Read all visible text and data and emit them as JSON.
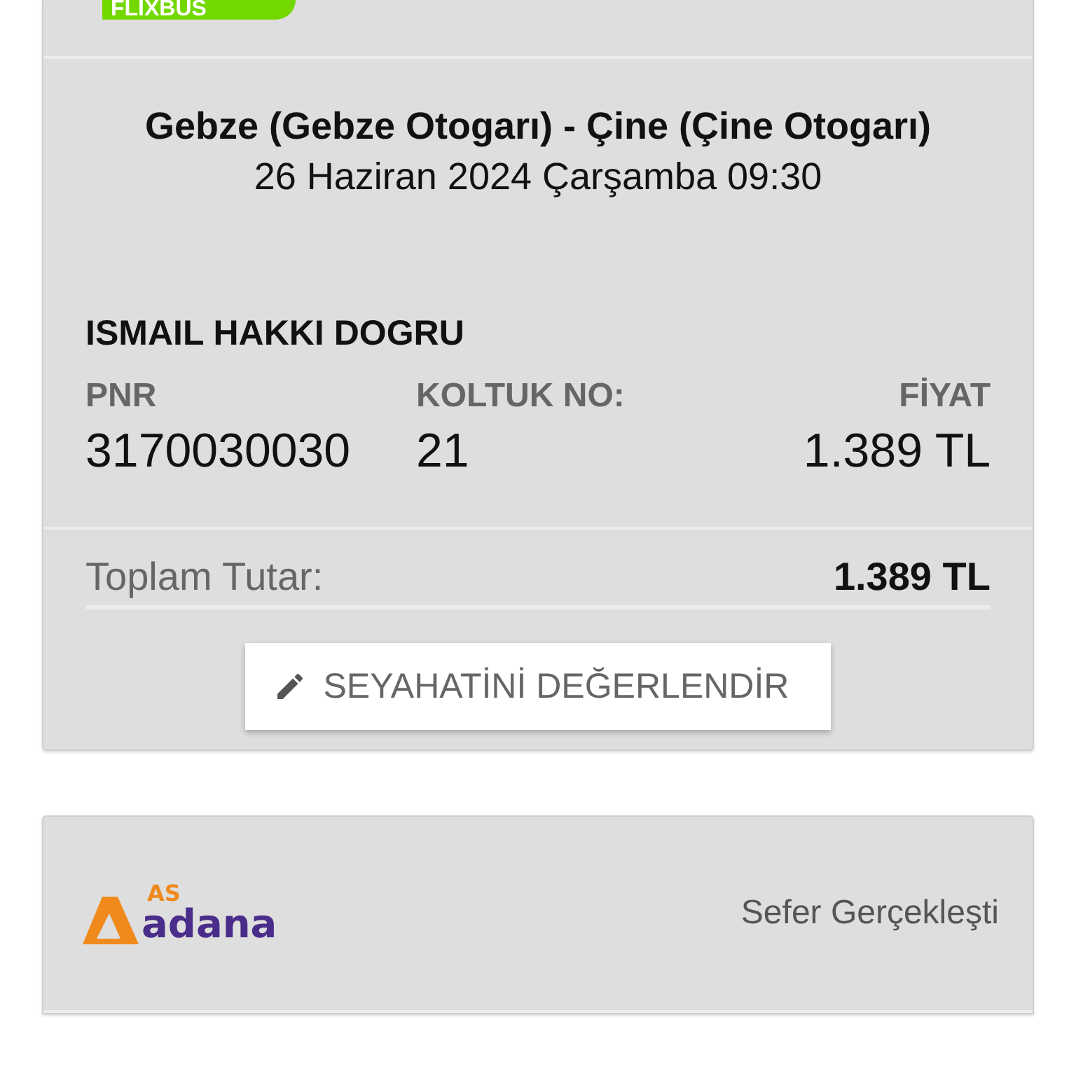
{
  "tickets": [
    {
      "company_logo": {
        "kind": "flixbus",
        "text": "FLIXBUS"
      },
      "route": "Gebze (Gebze Otogarı) - Çine (Çine Otogarı)",
      "departure": "26 Haziran 2024 Çarşamba 09:30",
      "passenger": "ISMAIL HAKKI DOGRU",
      "labels": {
        "pnr": "PNR",
        "seat": "KOLTUK NO:",
        "price": "FİYAT"
      },
      "values": {
        "pnr": "3170030030",
        "seat": "21",
        "price": "1.389 TL"
      },
      "total": {
        "label": "Toplam Tutar:",
        "value": "1.389 TL"
      },
      "rate_button": "SEYAHATİNİ DEĞERLENDİR"
    },
    {
      "company_logo": {
        "kind": "asadana",
        "text_top": "AS",
        "text_main": "adana"
      },
      "status": "Sefer Gerçekleşti"
    }
  ]
}
